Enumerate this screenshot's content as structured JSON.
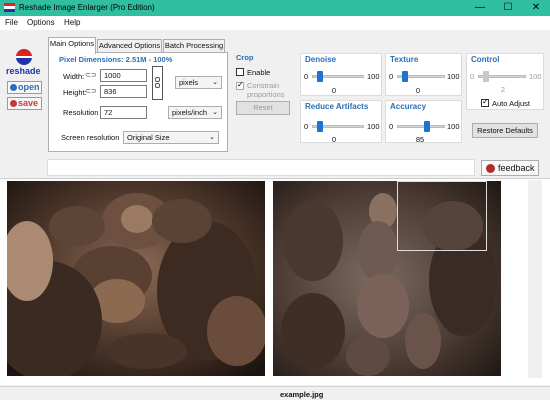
{
  "window": {
    "title": "Reshade Image Enlarger (Pro Edition)",
    "controls": {
      "minimize": "—",
      "maximize": "☐",
      "close": "✕"
    }
  },
  "menu": [
    "File",
    "Options",
    "Help"
  ],
  "sidebar": {
    "logo_text": "reshade",
    "open_label": "open",
    "save_label": "save"
  },
  "tabs": [
    "Main Options",
    "Advanced Options",
    "Batch Processing"
  ],
  "main_options": {
    "pixel_dimensions": "Pixel Dimensions:  2.51M - 100%",
    "width_label": "Width:",
    "width_value": "1000",
    "height_label": "Height:",
    "height_value": "836",
    "unit_select": "pixels",
    "resolution_label": "Resolution",
    "resolution_value": "72",
    "resolution_unit": "pixels/inch",
    "screen_resolution_label": "Screen resolution",
    "screen_resolution_value": "Original Size"
  },
  "crop": {
    "title": "Crop",
    "enable_label": "Enable",
    "enable_checked": false,
    "constrain_label": "Constrain proportions",
    "constrain_checked": true,
    "reset_label": "Reset"
  },
  "denoise": {
    "title": "Denoise",
    "min": "0",
    "max": "100",
    "value": "0"
  },
  "texture": {
    "title": "Texture",
    "min": "0",
    "max": "100",
    "value": "0"
  },
  "control": {
    "title": "Control",
    "min": "0",
    "max": "100",
    "value": "2",
    "auto_adjust_label": "Auto Adjust",
    "auto_adjust_checked": true
  },
  "reduce_artifacts": {
    "title": "Reduce Artifacts",
    "min": "0",
    "max": "100",
    "value": "0"
  },
  "accuracy": {
    "title": "Accuracy",
    "min": "0",
    "max": "100",
    "value": "85"
  },
  "restore_defaults_label": "Restore Defaults",
  "feedback_label": "feedback",
  "status": {
    "filename": "example.jpg"
  },
  "colors": {
    "titlebar": "#2fbfa0",
    "accent_blue": "#2a6fb8",
    "slider_thumb": "#1e73d2"
  }
}
